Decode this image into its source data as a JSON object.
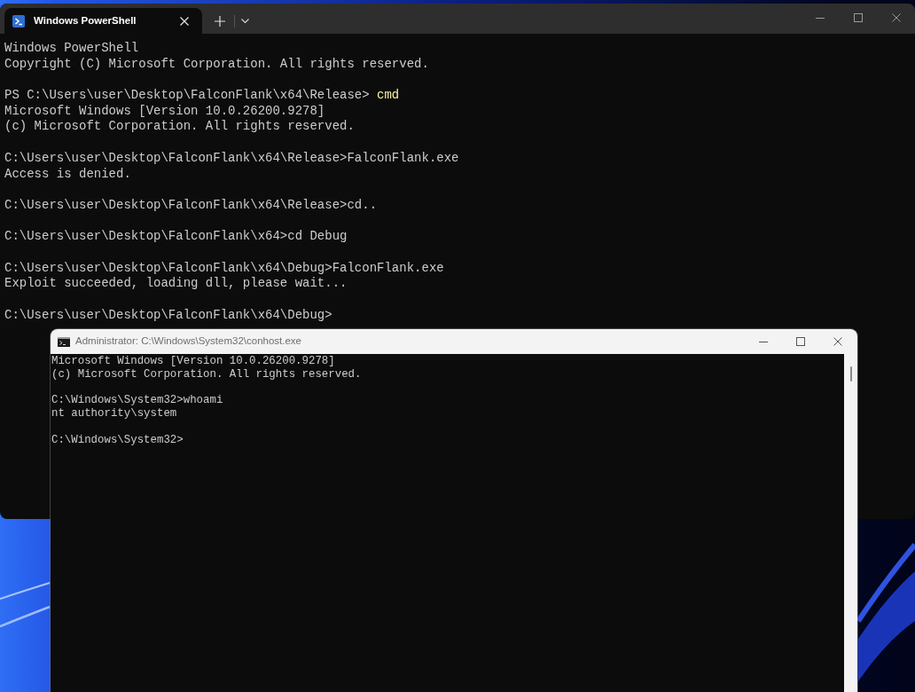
{
  "terminal_window": {
    "tabs": [
      {
        "title": "Windows PowerShell",
        "selected": true
      }
    ],
    "blocks": [
      [
        {
          "kind": "text",
          "text": "Windows PowerShell"
        },
        {
          "kind": "text",
          "text": "Copyright (C) Microsoft Corporation. All rights reserved."
        }
      ],
      [
        {
          "kind": "ps-command",
          "prompt": "PS C:\\Users\\user\\Desktop\\FalconFlank\\x64\\Release>",
          "command": "cmd"
        },
        {
          "kind": "text",
          "text": "Microsoft Windows [Version 10.0.26200.9278]"
        },
        {
          "kind": "text",
          "text": "(c) Microsoft Corporation. All rights reserved."
        }
      ],
      [
        {
          "kind": "text",
          "text": "C:\\Users\\user\\Desktop\\FalconFlank\\x64\\Release>FalconFlank.exe"
        },
        {
          "kind": "text",
          "text": "Access is denied."
        }
      ],
      [
        {
          "kind": "text",
          "text": "C:\\Users\\user\\Desktop\\FalconFlank\\x64\\Release>cd.."
        }
      ],
      [
        {
          "kind": "text",
          "text": "C:\\Users\\user\\Desktop\\FalconFlank\\x64>cd Debug"
        }
      ],
      [
        {
          "kind": "text",
          "text": "C:\\Users\\user\\Desktop\\FalconFlank\\x64\\Debug>FalconFlank.exe"
        },
        {
          "kind": "text",
          "text": "Exploit succeeded, loading dll, please wait..."
        }
      ],
      [
        {
          "kind": "text",
          "text": "C:\\Users\\user\\Desktop\\FalconFlank\\x64\\Debug>"
        }
      ]
    ]
  },
  "console_window": {
    "title": "Administrator: C:\\Windows\\System32\\conhost.exe",
    "blocks": [
      [
        {
          "kind": "text",
          "text": "Microsoft Windows [Version 10.0.26200.9278]"
        },
        {
          "kind": "text",
          "text": "(c) Microsoft Corporation. All rights reserved."
        }
      ],
      [
        {
          "kind": "text",
          "text": "C:\\Windows\\System32>whoami"
        },
        {
          "kind": "text",
          "text": "nt authority\\system"
        }
      ],
      [
        {
          "kind": "text",
          "text": "C:\\Windows\\System32>"
        }
      ]
    ]
  }
}
